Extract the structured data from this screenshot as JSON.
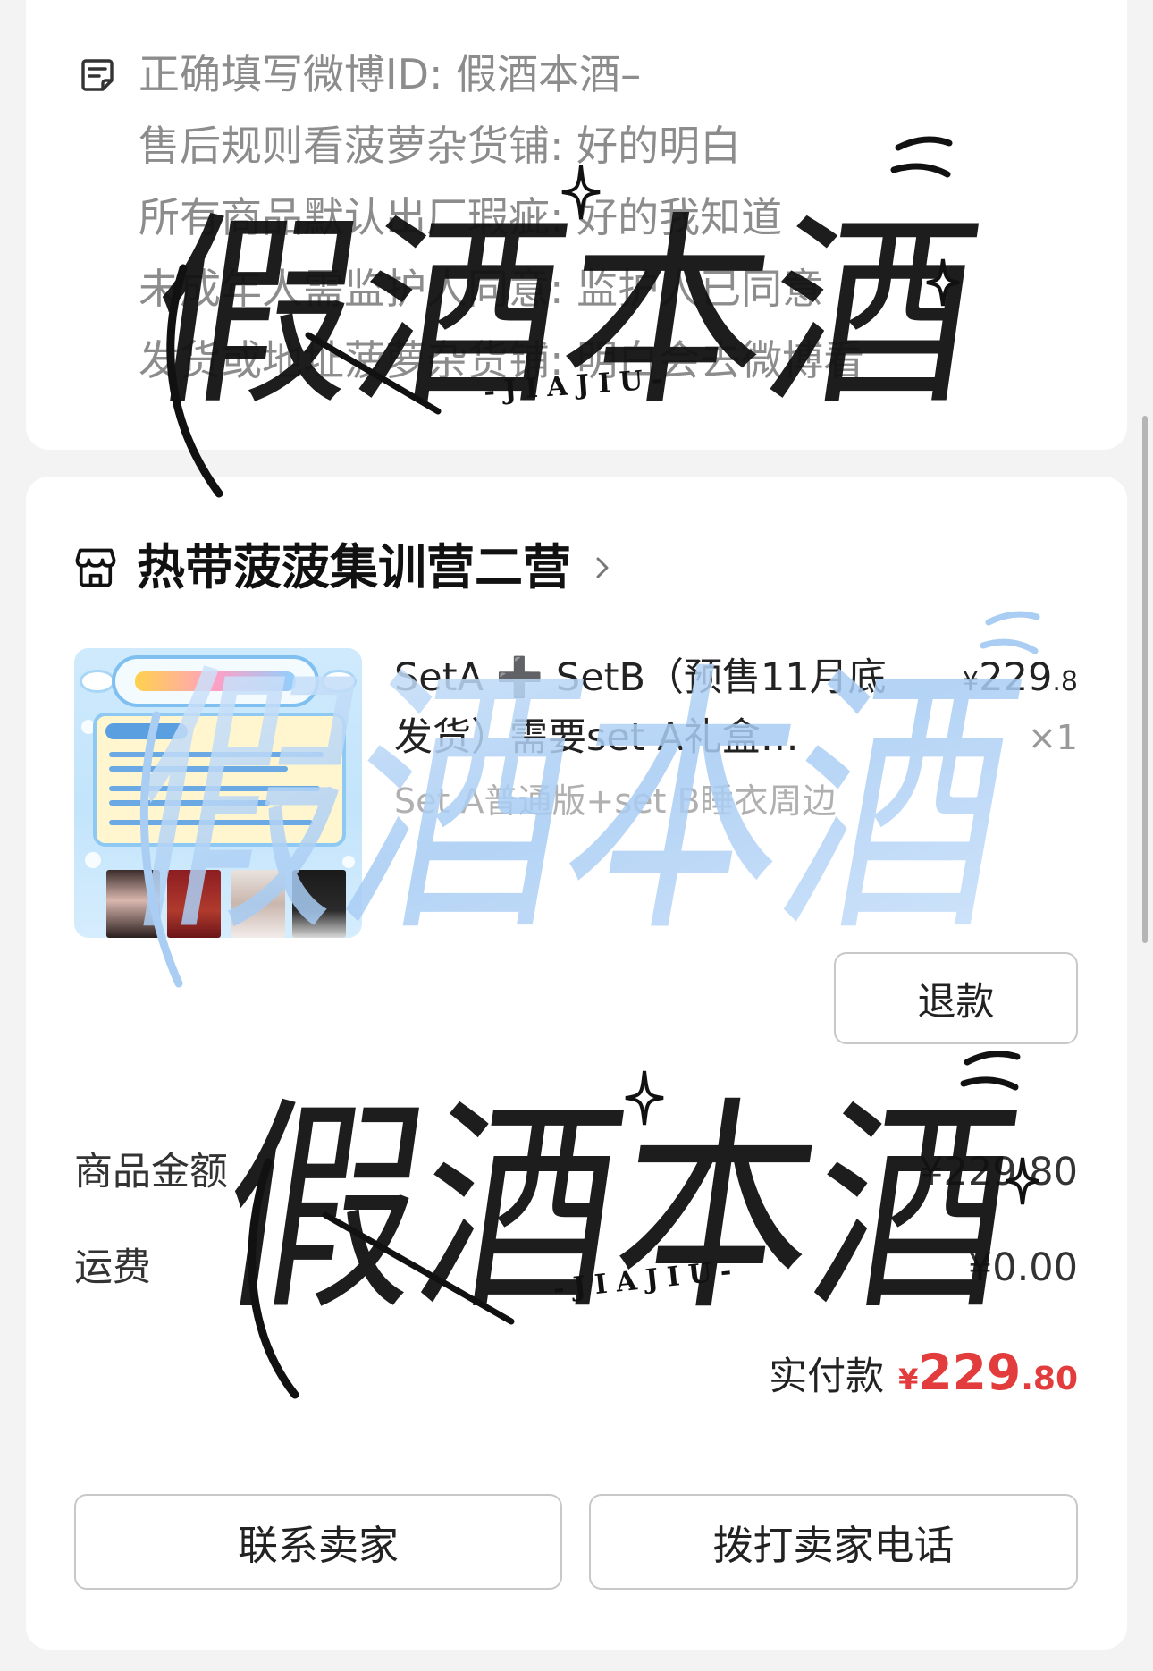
{
  "order_notes": {
    "lines": [
      "正确填写微博ID: 假酒本酒–",
      "售后规则看菠萝杂货铺: 好的明白",
      "所有商品默认出厂瑕疵: 好的我知道",
      "未成年人需监护人同意: 监护人已同意",
      "发货或地址菠萝杂货铺: 明白会去微博看"
    ]
  },
  "shop": {
    "name": "热带菠菠集训营二营"
  },
  "item": {
    "title_line1": "SetA ➕ SetB（预售11月底",
    "title_line2": "发货）需要set A礼盒…",
    "sku": "Set A普通版+set B睡衣周边",
    "price_symbol": "¥",
    "price_integer": "229",
    "price_decimal": ".8",
    "quantity": "×1",
    "refund_label": "退款"
  },
  "summary": {
    "goods_amount_label": "商品金额",
    "goods_amount_value": "¥229.80",
    "shipping_label": "运费",
    "shipping_value": "¥0.00",
    "paid_label": "实付款",
    "paid_symbol": "¥",
    "paid_integer": "229",
    "paid_decimal": ".80"
  },
  "actions": {
    "contact_seller": "联系卖家",
    "call_seller": "拨打卖家电话"
  },
  "watermark": {
    "text": "假酒本酒",
    "latin": "-JIAJIU-"
  },
  "icons": {
    "notes": "note-icon",
    "shop": "store-icon",
    "chevron": "chevron-right-icon",
    "sparkle": "sparkle-icon"
  },
  "colors": {
    "page_background": "#f3f3f3",
    "price_red": "#e33c3c",
    "watermark_black": "#111111",
    "watermark_blue": "#a9cdf3"
  }
}
